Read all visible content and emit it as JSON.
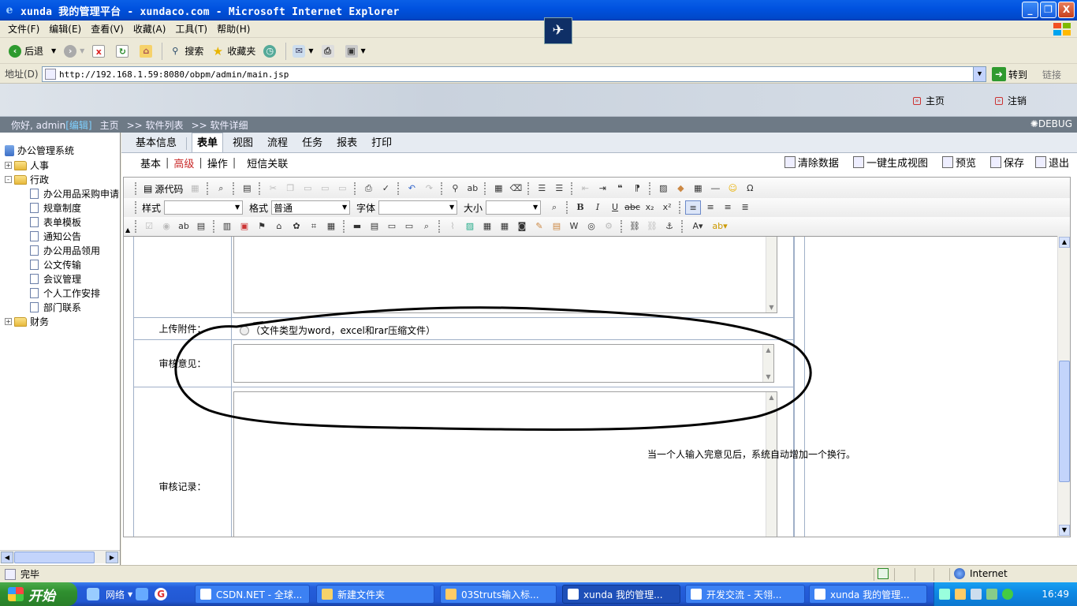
{
  "window": {
    "title": "xunda 我的管理平台 - xundaco.com - Microsoft Internet Explorer",
    "minimize": "_",
    "maximize": "❐",
    "close": "X"
  },
  "menu": [
    "文件(F)",
    "编辑(E)",
    "查看(V)",
    "收藏(A)",
    "工具(T)",
    "帮助(H)"
  ],
  "toolbar": {
    "back": "后退",
    "search": "搜索",
    "favorites": "收藏夹"
  },
  "address": {
    "label": "地址(D)",
    "url": "http://192.168.1.59:8080/obpm/admin/main.jsp",
    "go": "转到",
    "links": "链接"
  },
  "header": {
    "home": "主页",
    "logout": "注销"
  },
  "nav": {
    "greeting": "你好, admin",
    "edit": "[编辑]",
    "home": "主页",
    "crumb1": ">> 软件列表",
    "crumb2": ">> 软件详细",
    "debug": "DEBUG"
  },
  "tree": {
    "root": "办公管理系统",
    "nodes": [
      {
        "label": "人事",
        "expander": "+"
      },
      {
        "label": "行政",
        "expander": "-"
      }
    ],
    "children": [
      "办公用品采购申请",
      "规章制度",
      "表单模板",
      "通知公告",
      "办公用品领用",
      "公文传输",
      "会议管理",
      "个人工作安排",
      "部门联系"
    ],
    "last": {
      "label": "财务",
      "expander": "+"
    }
  },
  "tabs": {
    "primary": [
      "基本信息",
      "表单",
      "视图",
      "流程",
      "任务",
      "报表",
      "打印"
    ],
    "active_primary": "表单",
    "secondary": [
      "基本",
      "高级",
      "操作",
      "短信关联"
    ],
    "active_secondary": "高级"
  },
  "actions": {
    "clear": "清除数据",
    "generate_view": "一键生成视图",
    "preview": "预览",
    "save": "保存",
    "exit": "退出"
  },
  "editor": {
    "source": "源代码",
    "style_label": "样式",
    "format_label": "格式",
    "format_value": "普通",
    "font_label": "字体",
    "size_label": "大小"
  },
  "form": {
    "upload_label": "上传附件：",
    "upload_hint": "（文件类型为word，excel和rar压缩文件）",
    "review_opinion_label": "审核意见：",
    "review_record_label": "审核记录：",
    "note": "当一个人输入完意见后，系统自动增加一个换行。"
  },
  "status": {
    "text": "完毕",
    "zone": "Internet"
  },
  "taskbar": {
    "start": "开始",
    "network": "网络",
    "tasks": [
      "CSDN.NET - 全球...",
      "新建文件夹",
      "03Struts输入标...",
      "xunda 我的管理...",
      "开发交流 - 天翎...",
      "xunda 我的管理..."
    ],
    "clock": "16:49"
  }
}
